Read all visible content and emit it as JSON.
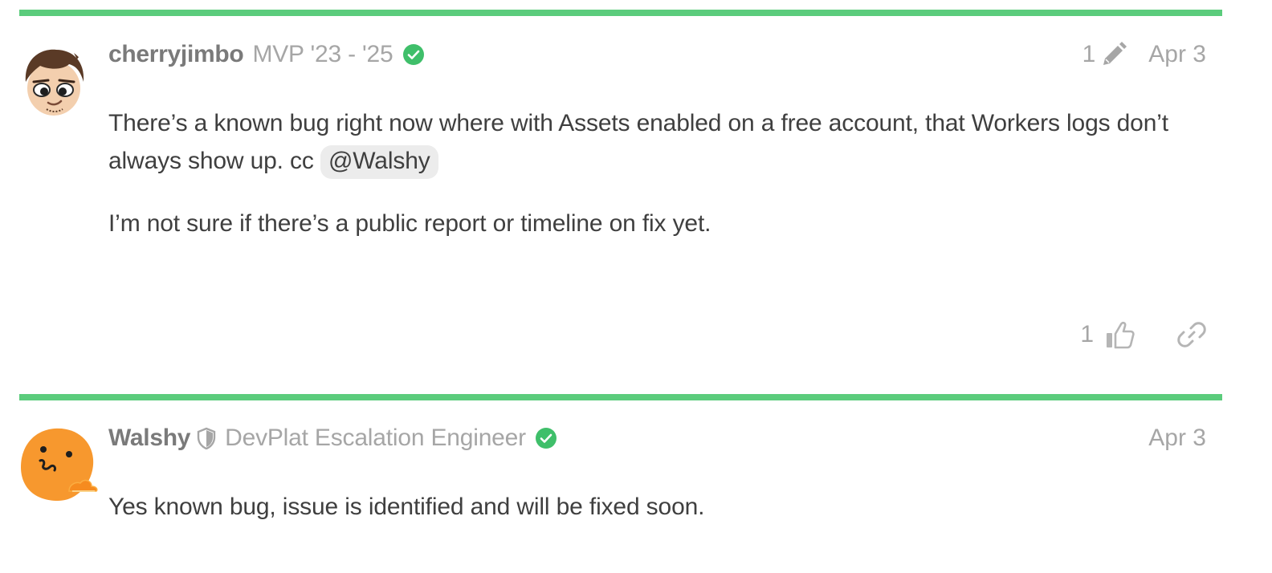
{
  "posts": [
    {
      "username": "cherryjimbo",
      "user_title": "MVP '23 - '25",
      "edit_count": "1",
      "date": "Apr 3",
      "body_part1": "There’s a known bug right now where with Assets enabled on a free account, that Workers logs don’t always show up. cc ",
      "mention": "@Walshy",
      "body_p2": "I’m not sure if there’s a public report or timeline on fix yet.",
      "like_count": "1",
      "avatar_icon": "cartoon-face-avatar",
      "verified_icon": "verified-check-icon"
    },
    {
      "username": "Walshy",
      "user_title": "DevPlat Escalation Engineer",
      "date": "Apr 3",
      "body_p1": "Yes known bug, issue is identified and will be fixed soon.",
      "avatar_icon": "orange-blob-face-avatar",
      "staff_icon": "shield-icon",
      "verified_icon": "verified-check-icon"
    }
  ],
  "colors": {
    "accent_bar": "#5bcc7c",
    "verified": "#3fbf6a",
    "muted_text": "#a6a6a6",
    "mention_bg": "#ececec",
    "avatar_orange": "#f7982e"
  }
}
